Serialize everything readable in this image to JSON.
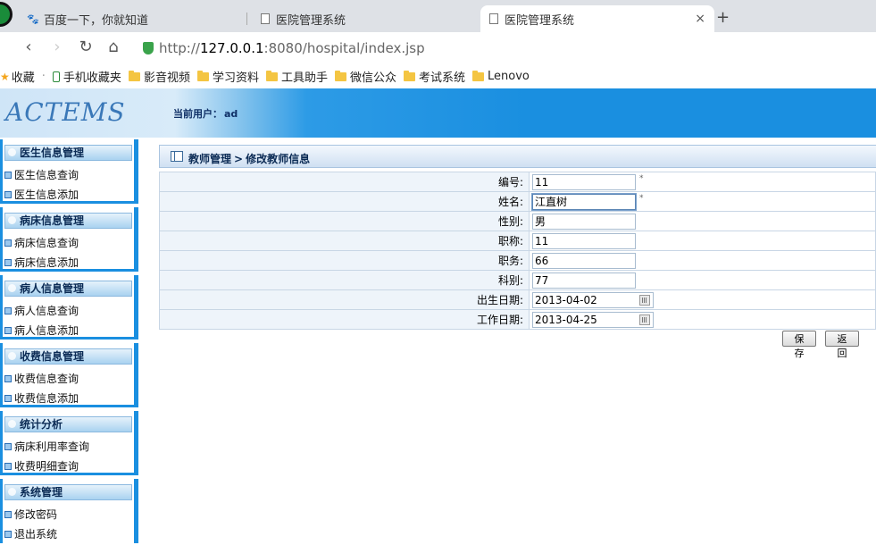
{
  "browser": {
    "tabs": [
      {
        "label": "百度一下，你就知道",
        "icon": "paw-icon"
      },
      {
        "label": "医院管理系统",
        "icon": "doc-icon"
      },
      {
        "label": "医院管理系统",
        "icon": "doc-icon",
        "active": true
      }
    ],
    "new_tab": "+",
    "close": "×",
    "url_prefix": "http://",
    "url_host": "127.0.0.1",
    "url_rest": ":8080/hospital/index.jsp",
    "bookmarks": [
      {
        "label": "收藏",
        "icon": "star-icon"
      },
      {
        "label": "手机收藏夹",
        "icon": "phone-icon"
      },
      {
        "label": "影音视频",
        "icon": "folder-icon"
      },
      {
        "label": "学习资料",
        "icon": "folder-icon"
      },
      {
        "label": "工具助手",
        "icon": "folder-icon"
      },
      {
        "label": "微信公众",
        "icon": "folder-icon"
      },
      {
        "label": "考试系统",
        "icon": "folder-icon"
      },
      {
        "label": "Lenovo",
        "icon": "folder-icon"
      }
    ]
  },
  "header": {
    "logo": "ACTEMS",
    "current_user_label": "当前用户：",
    "current_user": "ad"
  },
  "sidebar": {
    "groups": [
      {
        "title": "医生信息管理",
        "items": [
          "医生信息查询",
          "医生信息添加"
        ]
      },
      {
        "title": "病床信息管理",
        "items": [
          "病床信息查询",
          "病床信息添加"
        ]
      },
      {
        "title": "病人信息管理",
        "items": [
          "病人信息查询",
          "病人信息添加"
        ]
      },
      {
        "title": "收费信息管理",
        "items": [
          "收费信息查询",
          "收费信息添加"
        ]
      },
      {
        "title": "统计分析",
        "items": [
          "病床利用率查询",
          "收费明细查询"
        ]
      },
      {
        "title": "系统管理",
        "items": [
          "修改密码",
          "退出系统"
        ]
      }
    ]
  },
  "main": {
    "breadcrumb": [
      "教师管理",
      "修改教师信息"
    ],
    "breadcrumb_sep": ">",
    "form": [
      {
        "label": "编号:",
        "value": "11",
        "required": "*"
      },
      {
        "label": "姓名:",
        "value": "江直树",
        "required": "*"
      },
      {
        "label": "性别:",
        "value": "男"
      },
      {
        "label": "职称:",
        "value": "11"
      },
      {
        "label": "职务:",
        "value": "66"
      },
      {
        "label": "科别:",
        "value": "77"
      },
      {
        "label": "出生日期:",
        "value": "2013-04-02",
        "date": true
      },
      {
        "label": "工作日期:",
        "value": "2013-04-25",
        "date": true
      }
    ],
    "save_label": "保 存",
    "back_label": "返 回"
  },
  "colors": {
    "accent": "#1a8fe0",
    "header_text": "#0b2b55",
    "label_bg": "#eef4fa"
  }
}
